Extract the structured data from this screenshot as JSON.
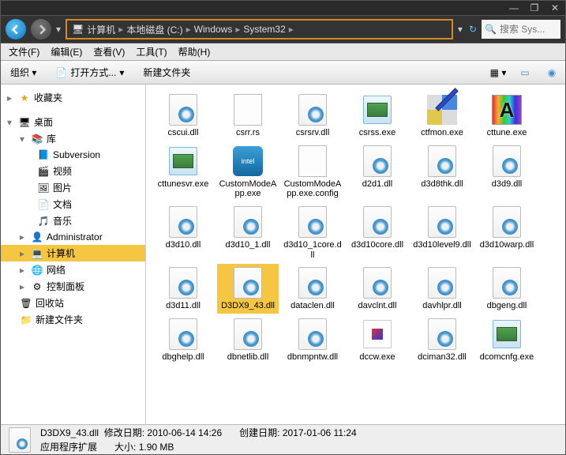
{
  "window_controls": {
    "min": "—",
    "max": "❐",
    "close": "✕"
  },
  "search": {
    "placeholder": "搜索 Sys..."
  },
  "breadcrumb": [
    "计算机",
    "本地磁盘 (C:)",
    "Windows",
    "System32"
  ],
  "menu": {
    "file": "文件(F)",
    "edit": "编辑(E)",
    "view": "查看(V)",
    "tools": "工具(T)",
    "help": "帮助(H)"
  },
  "toolbar": {
    "organize": "组织 ▾",
    "openwith": "打开方式...",
    "newfolder": "新建文件夹"
  },
  "sidebar": {
    "favorites": "收藏夹",
    "desktop": "桌面",
    "libraries": "库",
    "lib_items": [
      "Subversion",
      "视频",
      "图片",
      "文档",
      "音乐"
    ],
    "administrator": "Administrator",
    "computer": "计算机",
    "network": "网络",
    "control_panel": "控制面板",
    "recycle_bin": "回收站",
    "new_folder": "新建文件夹"
  },
  "files": [
    {
      "name": "cscui.dll",
      "type": "dll"
    },
    {
      "name": "csrr.rs",
      "type": "config"
    },
    {
      "name": "csrsrv.dll",
      "type": "dll"
    },
    {
      "name": "csrss.exe",
      "type": "exe"
    },
    {
      "name": "ctfmon.exe",
      "type": "ctfmon"
    },
    {
      "name": "cttune.exe",
      "type": "cttune"
    },
    {
      "name": "cttunesvr.exe",
      "type": "exe"
    },
    {
      "name": "CustomModeApp.exe",
      "type": "custom"
    },
    {
      "name": "CustomModeApp.exe.config",
      "type": "config"
    },
    {
      "name": "d2d1.dll",
      "type": "dll"
    },
    {
      "name": "d3d8thk.dll",
      "type": "dll"
    },
    {
      "name": "d3d9.dll",
      "type": "dll"
    },
    {
      "name": "d3d10.dll",
      "type": "dll"
    },
    {
      "name": "d3d10_1.dll",
      "type": "dll"
    },
    {
      "name": "d3d10_1core.dll",
      "type": "dll"
    },
    {
      "name": "d3d10core.dll",
      "type": "dll"
    },
    {
      "name": "d3d10level9.dll",
      "type": "dll"
    },
    {
      "name": "d3d10warp.dll",
      "type": "dll"
    },
    {
      "name": "d3d11.dll",
      "type": "dll"
    },
    {
      "name": "D3DX9_43.dll",
      "type": "dll",
      "selected": true
    },
    {
      "name": "dataclen.dll",
      "type": "dll"
    },
    {
      "name": "davclnt.dll",
      "type": "dll"
    },
    {
      "name": "davhlpr.dll",
      "type": "dll"
    },
    {
      "name": "dbgeng.dll",
      "type": "dll"
    },
    {
      "name": "dbghelp.dll",
      "type": "dll"
    },
    {
      "name": "dbnetlib.dll",
      "type": "dll"
    },
    {
      "name": "dbnmpntw.dll",
      "type": "dll"
    },
    {
      "name": "dccw.exe",
      "type": "dccw"
    },
    {
      "name": "dciman32.dll",
      "type": "dll"
    },
    {
      "name": "dcomcnfg.exe",
      "type": "exe"
    }
  ],
  "status": {
    "filename": "D3DX9_43.dll",
    "mod_label": "修改日期:",
    "mod_value": "2010-06-14 14:26",
    "create_label": "创建日期:",
    "create_value": "2017-01-06 11:24",
    "type_label": "应用程序扩展",
    "size_label": "大小:",
    "size_value": "1.90 MB"
  }
}
